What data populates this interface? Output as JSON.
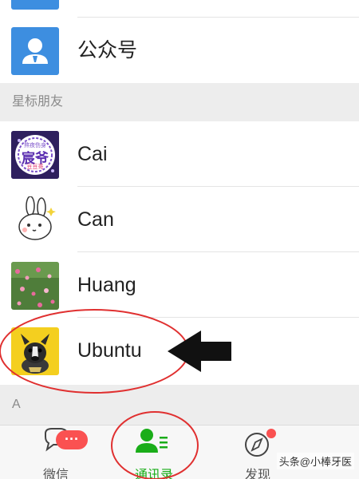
{
  "rows": [
    {
      "label": "公众号",
      "icon": "official-account-icon",
      "color": "#3d8ee0"
    },
    {
      "label": "Cai",
      "icon": "contact-avatar-cai"
    },
    {
      "label": "Can",
      "icon": "contact-avatar-can"
    },
    {
      "label": "Huang",
      "icon": "contact-avatar-huang"
    },
    {
      "label": "Ubuntu",
      "icon": "contact-avatar-ubuntu"
    }
  ],
  "sections": {
    "starred": "星标朋友",
    "a": "A"
  },
  "avatar_text": {
    "cai_line1": "熬夜伤身",
    "cai_line2": "宸爷",
    "cai_line3": "豆豆哥"
  },
  "tabs": [
    {
      "label": "微信",
      "icon": "chat-bubble-icon",
      "badge": "···"
    },
    {
      "label": "通讯录",
      "icon": "contacts-icon",
      "active": true
    },
    {
      "label": "发现",
      "icon": "compass-icon"
    }
  ],
  "watermark": "头条@小棒牙医",
  "colors": {
    "accent_green": "#1aad19",
    "annotation_red": "#e03030",
    "badge_red": "#fa5151",
    "section_bg": "#ededed"
  }
}
